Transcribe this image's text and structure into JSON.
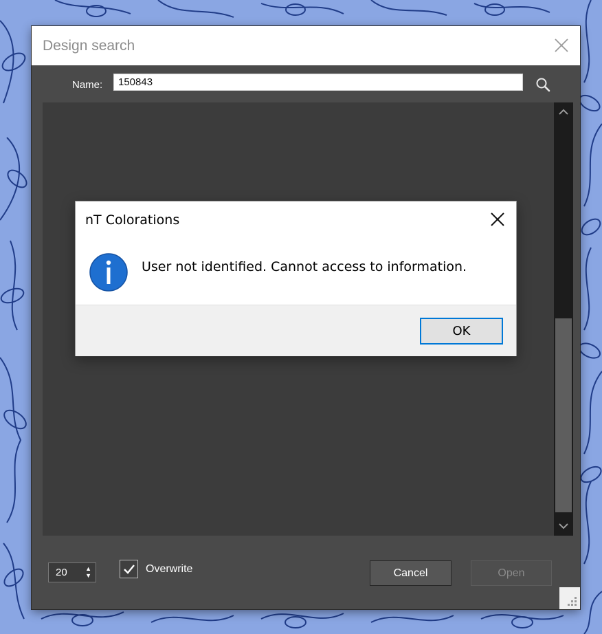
{
  "design_search": {
    "title": "Design search",
    "name_label": "Name:",
    "name_value": "150843",
    "page_size": "20",
    "overwrite_label": "Overwrite",
    "overwrite_checked": true,
    "cancel_label": "Cancel",
    "open_label": "Open",
    "open_enabled": false
  },
  "message_box": {
    "title": "nT Colorations",
    "text": "User not identified. Cannot access to information.",
    "ok_label": "OK",
    "icon": "info-icon",
    "icon_color": "#1e6fd0"
  },
  "colors": {
    "background_pattern": "#8aa6e3",
    "pattern_ink": "#0e2a78",
    "window_body": "#4a4a4a",
    "results_area": "#3c3c3c",
    "accent": "#0078d7"
  }
}
